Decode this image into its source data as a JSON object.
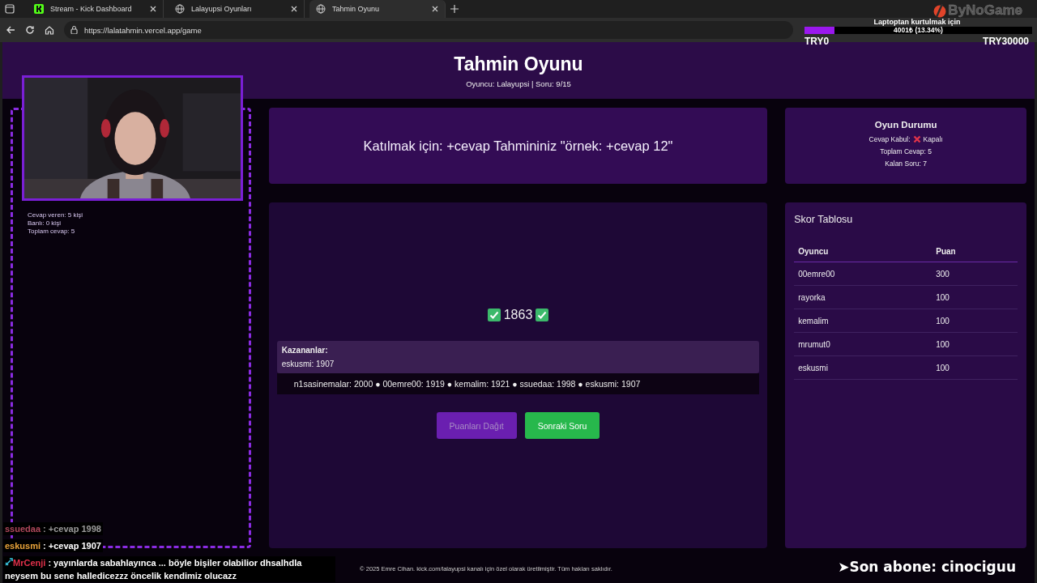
{
  "browser": {
    "tabs": [
      {
        "title": "Stream - Kick Dashboard",
        "kind": "kick",
        "selected": false
      },
      {
        "title": "Lalayupsi Oyunları",
        "kind": "globe",
        "selected": false
      },
      {
        "title": "Tahmin Oyunu",
        "kind": "globe",
        "selected": true
      }
    ],
    "url": "https://lalatahmin.vercel.app/game"
  },
  "header": {
    "title": "Tahmin Oyunu",
    "subtitle": "Oyuncu: Lalayupsi | Soru: 9/15"
  },
  "side_stats": [
    "Cevap veren: 5 kişi",
    "Banlı: 0 kişi",
    "Toplam cevap: 5"
  ],
  "prompt": "Katılmak için: +cevap Tahmininiz \"örnek: +cevap 12\"",
  "answer": {
    "value": "1863",
    "correct": true
  },
  "winners": {
    "title": "Kazananlar:",
    "entries": [
      "eskusmi: 1907"
    ]
  },
  "guesses": "n1sasinemalar: 2000 ● 00emre00: 1919 ● kemalim: 1921 ● ssuedaa: 1998 ● eskusmi: 1907",
  "buttons": [
    {
      "label": "Puanları Dağıt",
      "kind": "primary",
      "disabled": true
    },
    {
      "label": "Sonraki Soru",
      "kind": "success",
      "disabled": false
    }
  ],
  "status": {
    "title": "Oyun Durumu",
    "accept_label": "Cevap Kabul:",
    "accept_open": false,
    "accept_value": "Kapalı",
    "lines": [
      "Toplam Cevap: 5",
      "Kalan Soru: 7"
    ]
  },
  "scoreboard": {
    "title": "Skor Tablosu",
    "columns": [
      "Oyuncu",
      "Puan"
    ],
    "rows": [
      [
        "00emre00",
        "300"
      ],
      [
        "rayorka",
        "100"
      ],
      [
        "kemalim",
        "100"
      ],
      [
        "mrumut0",
        "100"
      ],
      [
        "eskusmi",
        "100"
      ]
    ]
  },
  "footer": "© 2025 Emre Cihan. kick.com/lalayupsi kanalı için özel olarak üretilmiştir. Tüm hakları saklıdır.",
  "stream_overlay": {
    "goal": {
      "brand": "ByNoGame",
      "title": "Laptoptan kurtulmak için",
      "amount": "4001₺ (13.34%)",
      "level": 0.1334,
      "min": "TRY0",
      "max": "TRY30000"
    },
    "chat": [
      {
        "user": "ssuedaa",
        "color": "#b0485c",
        "text": ": +cevap 1998",
        "faded": true,
        "badge": false
      },
      {
        "user": "eskusmi",
        "color": "#e8a33a",
        "text": ": +cevap 1907",
        "faded": false,
        "badge": false
      },
      {
        "user": "MrCenji",
        "color": "#e0304a",
        "text": ": yayınlarda sabahlayınca ... böyle bişiler olabilior dhsalhdla neysem bu sene halledicezzz öncelik kendimiz olucazz",
        "faded": false,
        "badge": true
      }
    ],
    "last_subscriber": "➤Son abone: cinociguu"
  }
}
